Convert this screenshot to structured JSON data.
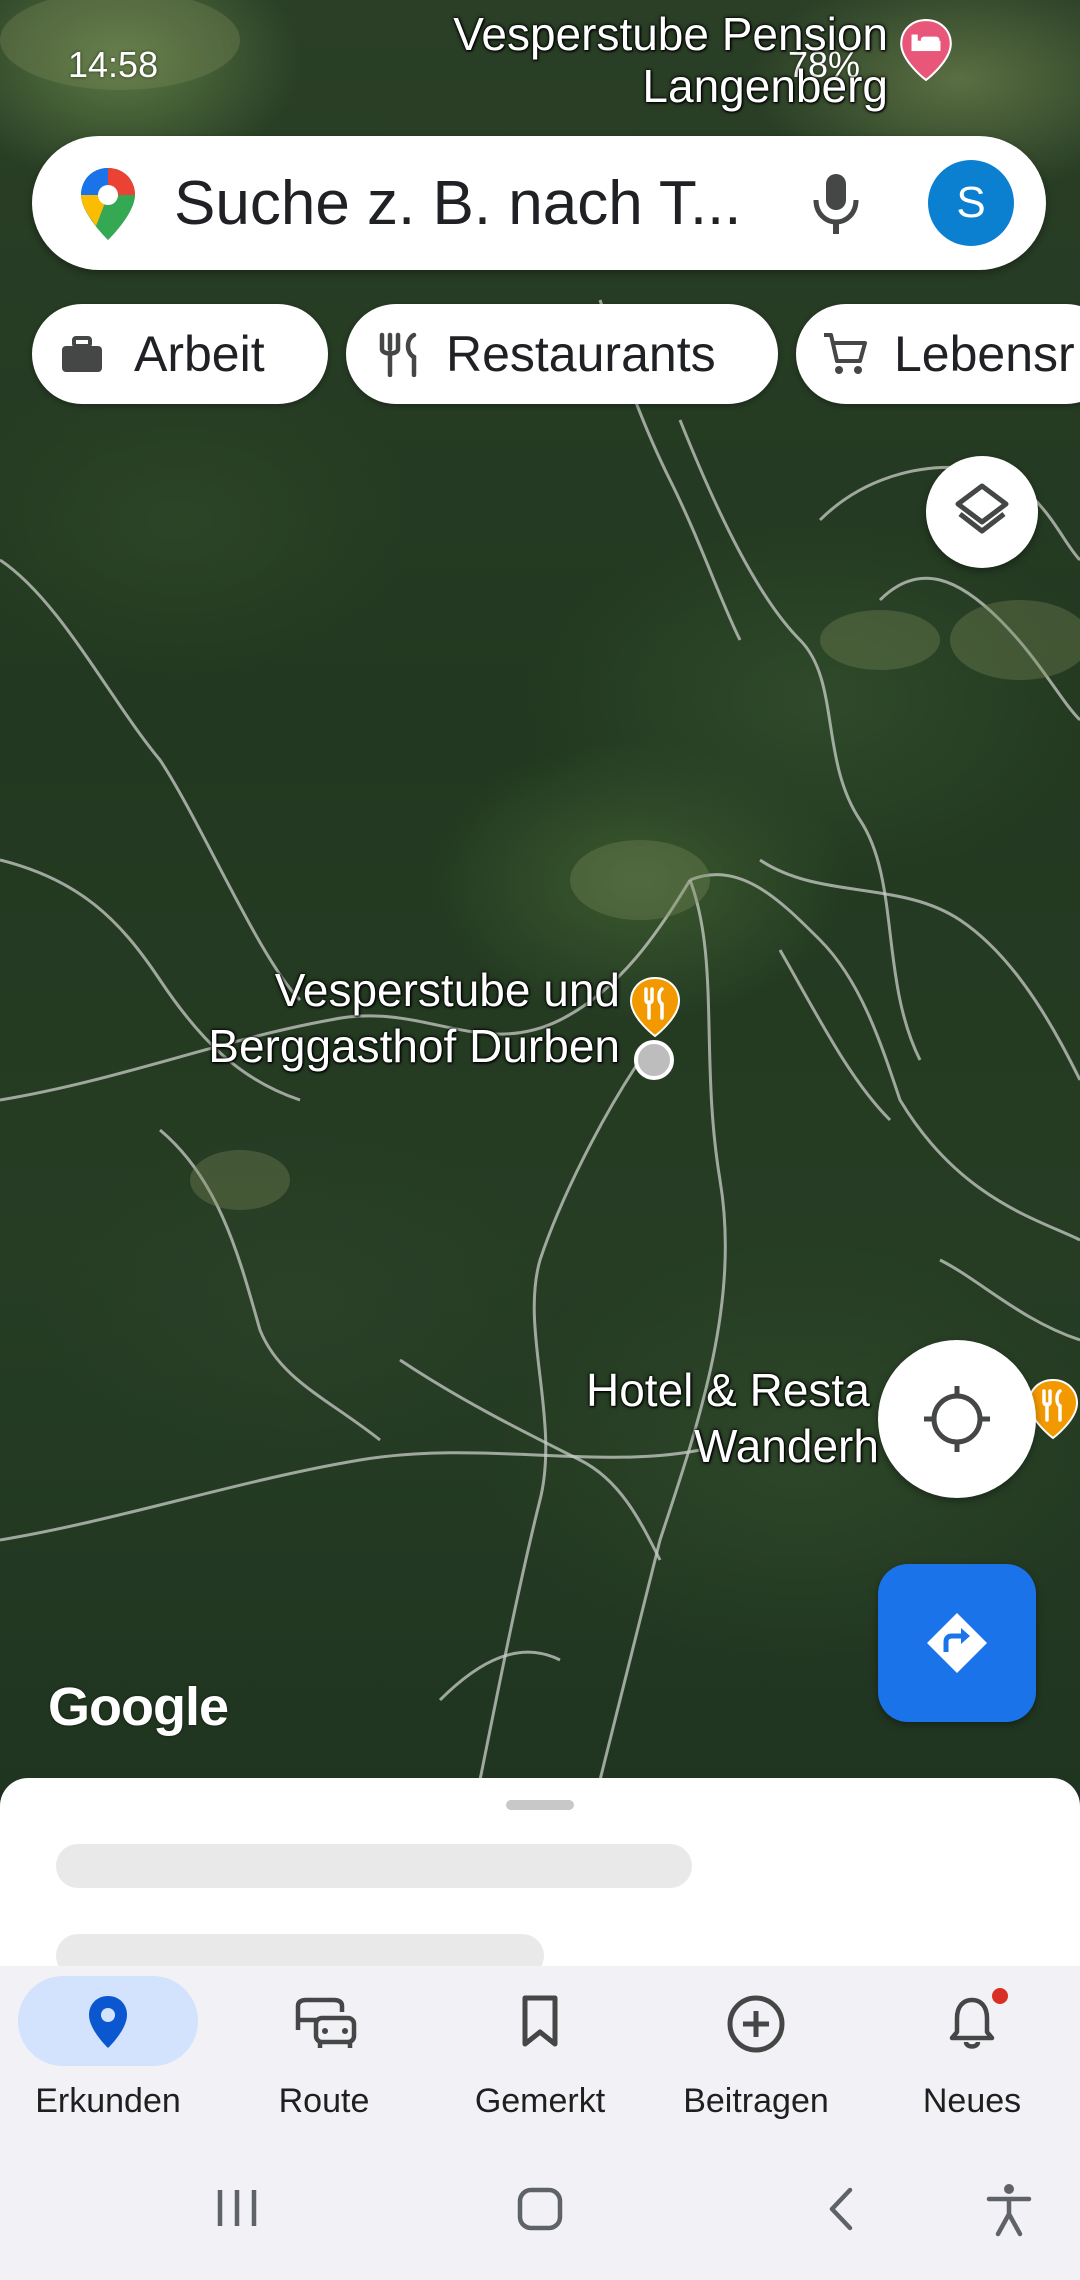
{
  "status_bar": {
    "time": "14:58",
    "battery": "78%"
  },
  "search": {
    "placeholder": "Suche z. B. nach T...",
    "avatar_initial": "S"
  },
  "chips": [
    {
      "label": "Arbeit",
      "icon": "briefcase-icon"
    },
    {
      "label": "Restaurants",
      "icon": "fork-knife-icon"
    },
    {
      "label": "Lebensr",
      "icon": "cart-icon"
    }
  ],
  "map": {
    "labels": {
      "top_place_line1": "Vesperstube Pension",
      "top_place_line2": "Langenberg",
      "main_place_line1": "Vesperstube und",
      "main_place_line2": "Berggasthof Durben",
      "hotel_line1": "Hotel & Resta",
      "hotel_line2": "Wanderh"
    },
    "attribution": "Google",
    "colors": {
      "food_pin": "#f29900",
      "hotel_pin": "#e8577a",
      "directions_fab": "#1a73e8"
    }
  },
  "nav": {
    "items": [
      {
        "label": "Erkunden",
        "icon": "location-pin-icon",
        "active": true
      },
      {
        "label": "Route",
        "icon": "commute-icon",
        "active": false
      },
      {
        "label": "Gemerkt",
        "icon": "bookmark-icon",
        "active": false
      },
      {
        "label": "Beitragen",
        "icon": "add-circle-icon",
        "active": false
      },
      {
        "label": "Neues",
        "icon": "bell-icon",
        "active": false,
        "badge": true
      }
    ],
    "active_color": "#d3e3fd"
  }
}
